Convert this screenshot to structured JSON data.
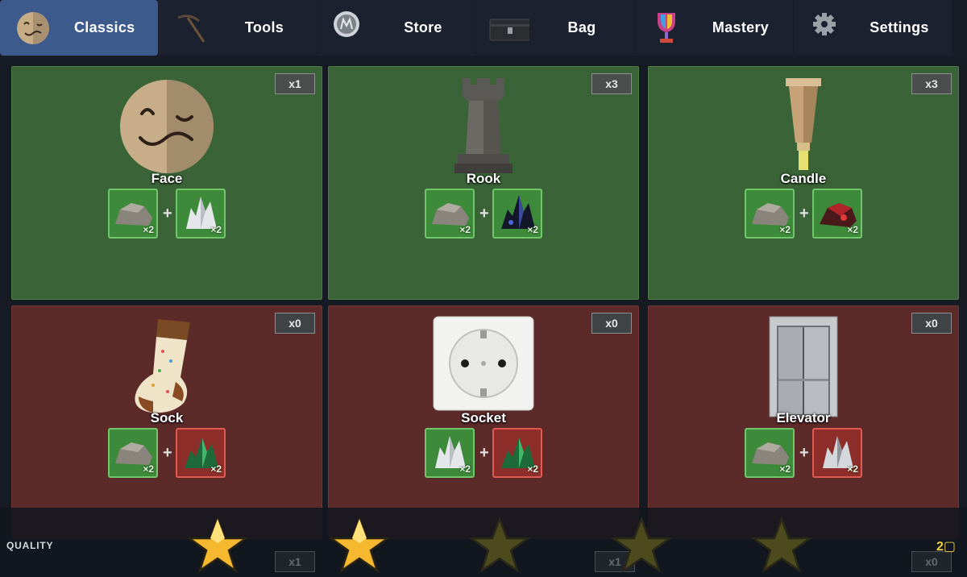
{
  "nav": {
    "tabs": [
      {
        "label": "Classics",
        "icon": "face-icon",
        "active": true
      },
      {
        "label": "Tools",
        "icon": "pickaxe-icon",
        "active": false
      },
      {
        "label": "Store",
        "icon": "coin-icon",
        "active": false
      },
      {
        "label": "Bag",
        "icon": "case-icon",
        "active": false
      },
      {
        "label": "Mastery",
        "icon": "trophy-icon",
        "active": false
      },
      {
        "label": "Settings",
        "icon": "gear-icon",
        "active": false
      }
    ]
  },
  "cards": [
    {
      "name": "Face",
      "count": "x1",
      "state": "craftable",
      "ingredients": [
        {
          "item": "rock",
          "qty": "×2",
          "ok": true
        },
        {
          "item": "white-crystal",
          "qty": "×2",
          "ok": true
        }
      ]
    },
    {
      "name": "Rook",
      "count": "x3",
      "state": "craftable",
      "ingredients": [
        {
          "item": "rock",
          "qty": "×2",
          "ok": true
        },
        {
          "item": "dark-crystal",
          "qty": "×2",
          "ok": true
        }
      ]
    },
    {
      "name": "Candle",
      "count": "x3",
      "state": "craftable",
      "ingredients": [
        {
          "item": "rock",
          "qty": "×2",
          "ok": true
        },
        {
          "item": "red-crystal",
          "qty": "×2",
          "ok": true
        }
      ]
    },
    {
      "name": "Sock",
      "count": "x0",
      "state": "locked",
      "ingredients": [
        {
          "item": "rock",
          "qty": "×2",
          "ok": true
        },
        {
          "item": "green-crystal",
          "qty": "×2",
          "ok": false
        }
      ]
    },
    {
      "name": "Socket",
      "count": "x0",
      "state": "locked",
      "ingredients": [
        {
          "item": "white-crystal",
          "qty": "×2",
          "ok": true
        },
        {
          "item": "green-crystal",
          "qty": "×2",
          "ok": false
        }
      ]
    },
    {
      "name": "Elevator",
      "count": "x0",
      "state": "locked",
      "ingredients": [
        {
          "item": "rock",
          "qty": "×2",
          "ok": true
        },
        {
          "item": "silver-crystal",
          "qty": "×2",
          "ok": false
        }
      ]
    }
  ],
  "quality": {
    "label": "QUALITY",
    "stars_filled": 2,
    "stars_total": 5,
    "value": "2▢"
  },
  "background_counts": [
    "x1",
    "x1",
    "x0"
  ],
  "colors": {
    "active_tab": "#3c5a8c",
    "craftable_card": "#3a6437",
    "locked_card": "#5c2a29",
    "ok_slot": "#3d8a3a",
    "missing_slot": "#8e2e2a",
    "star": "#f5b82e"
  }
}
